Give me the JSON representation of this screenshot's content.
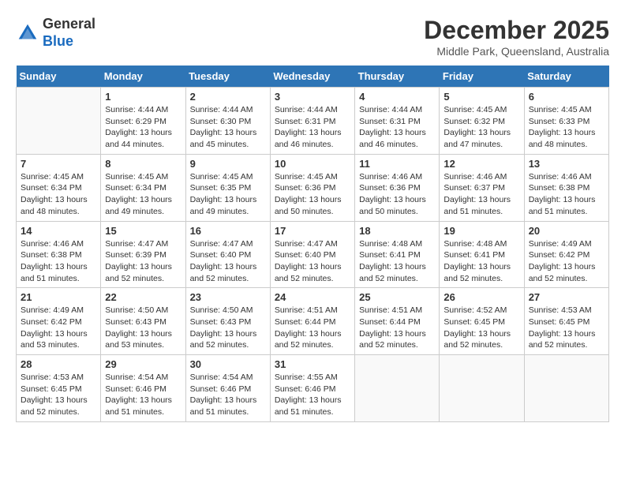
{
  "header": {
    "logo_line1": "General",
    "logo_line2": "Blue",
    "month": "December 2025",
    "location": "Middle Park, Queensland, Australia"
  },
  "weekdays": [
    "Sunday",
    "Monday",
    "Tuesday",
    "Wednesday",
    "Thursday",
    "Friday",
    "Saturday"
  ],
  "weeks": [
    [
      {
        "day": "",
        "info": ""
      },
      {
        "day": "1",
        "info": "Sunrise: 4:44 AM\nSunset: 6:29 PM\nDaylight: 13 hours\nand 44 minutes."
      },
      {
        "day": "2",
        "info": "Sunrise: 4:44 AM\nSunset: 6:30 PM\nDaylight: 13 hours\nand 45 minutes."
      },
      {
        "day": "3",
        "info": "Sunrise: 4:44 AM\nSunset: 6:31 PM\nDaylight: 13 hours\nand 46 minutes."
      },
      {
        "day": "4",
        "info": "Sunrise: 4:44 AM\nSunset: 6:31 PM\nDaylight: 13 hours\nand 46 minutes."
      },
      {
        "day": "5",
        "info": "Sunrise: 4:45 AM\nSunset: 6:32 PM\nDaylight: 13 hours\nand 47 minutes."
      },
      {
        "day": "6",
        "info": "Sunrise: 4:45 AM\nSunset: 6:33 PM\nDaylight: 13 hours\nand 48 minutes."
      }
    ],
    [
      {
        "day": "7",
        "info": "Sunrise: 4:45 AM\nSunset: 6:34 PM\nDaylight: 13 hours\nand 48 minutes."
      },
      {
        "day": "8",
        "info": "Sunrise: 4:45 AM\nSunset: 6:34 PM\nDaylight: 13 hours\nand 49 minutes."
      },
      {
        "day": "9",
        "info": "Sunrise: 4:45 AM\nSunset: 6:35 PM\nDaylight: 13 hours\nand 49 minutes."
      },
      {
        "day": "10",
        "info": "Sunrise: 4:45 AM\nSunset: 6:36 PM\nDaylight: 13 hours\nand 50 minutes."
      },
      {
        "day": "11",
        "info": "Sunrise: 4:46 AM\nSunset: 6:36 PM\nDaylight: 13 hours\nand 50 minutes."
      },
      {
        "day": "12",
        "info": "Sunrise: 4:46 AM\nSunset: 6:37 PM\nDaylight: 13 hours\nand 51 minutes."
      },
      {
        "day": "13",
        "info": "Sunrise: 4:46 AM\nSunset: 6:38 PM\nDaylight: 13 hours\nand 51 minutes."
      }
    ],
    [
      {
        "day": "14",
        "info": "Sunrise: 4:46 AM\nSunset: 6:38 PM\nDaylight: 13 hours\nand 51 minutes."
      },
      {
        "day": "15",
        "info": "Sunrise: 4:47 AM\nSunset: 6:39 PM\nDaylight: 13 hours\nand 52 minutes."
      },
      {
        "day": "16",
        "info": "Sunrise: 4:47 AM\nSunset: 6:40 PM\nDaylight: 13 hours\nand 52 minutes."
      },
      {
        "day": "17",
        "info": "Sunrise: 4:47 AM\nSunset: 6:40 PM\nDaylight: 13 hours\nand 52 minutes."
      },
      {
        "day": "18",
        "info": "Sunrise: 4:48 AM\nSunset: 6:41 PM\nDaylight: 13 hours\nand 52 minutes."
      },
      {
        "day": "19",
        "info": "Sunrise: 4:48 AM\nSunset: 6:41 PM\nDaylight: 13 hours\nand 52 minutes."
      },
      {
        "day": "20",
        "info": "Sunrise: 4:49 AM\nSunset: 6:42 PM\nDaylight: 13 hours\nand 52 minutes."
      }
    ],
    [
      {
        "day": "21",
        "info": "Sunrise: 4:49 AM\nSunset: 6:42 PM\nDaylight: 13 hours\nand 53 minutes."
      },
      {
        "day": "22",
        "info": "Sunrise: 4:50 AM\nSunset: 6:43 PM\nDaylight: 13 hours\nand 53 minutes."
      },
      {
        "day": "23",
        "info": "Sunrise: 4:50 AM\nSunset: 6:43 PM\nDaylight: 13 hours\nand 52 minutes."
      },
      {
        "day": "24",
        "info": "Sunrise: 4:51 AM\nSunset: 6:44 PM\nDaylight: 13 hours\nand 52 minutes."
      },
      {
        "day": "25",
        "info": "Sunrise: 4:51 AM\nSunset: 6:44 PM\nDaylight: 13 hours\nand 52 minutes."
      },
      {
        "day": "26",
        "info": "Sunrise: 4:52 AM\nSunset: 6:45 PM\nDaylight: 13 hours\nand 52 minutes."
      },
      {
        "day": "27",
        "info": "Sunrise: 4:53 AM\nSunset: 6:45 PM\nDaylight: 13 hours\nand 52 minutes."
      }
    ],
    [
      {
        "day": "28",
        "info": "Sunrise: 4:53 AM\nSunset: 6:45 PM\nDaylight: 13 hours\nand 52 minutes."
      },
      {
        "day": "29",
        "info": "Sunrise: 4:54 AM\nSunset: 6:46 PM\nDaylight: 13 hours\nand 51 minutes."
      },
      {
        "day": "30",
        "info": "Sunrise: 4:54 AM\nSunset: 6:46 PM\nDaylight: 13 hours\nand 51 minutes."
      },
      {
        "day": "31",
        "info": "Sunrise: 4:55 AM\nSunset: 6:46 PM\nDaylight: 13 hours\nand 51 minutes."
      },
      {
        "day": "",
        "info": ""
      },
      {
        "day": "",
        "info": ""
      },
      {
        "day": "",
        "info": ""
      }
    ]
  ]
}
